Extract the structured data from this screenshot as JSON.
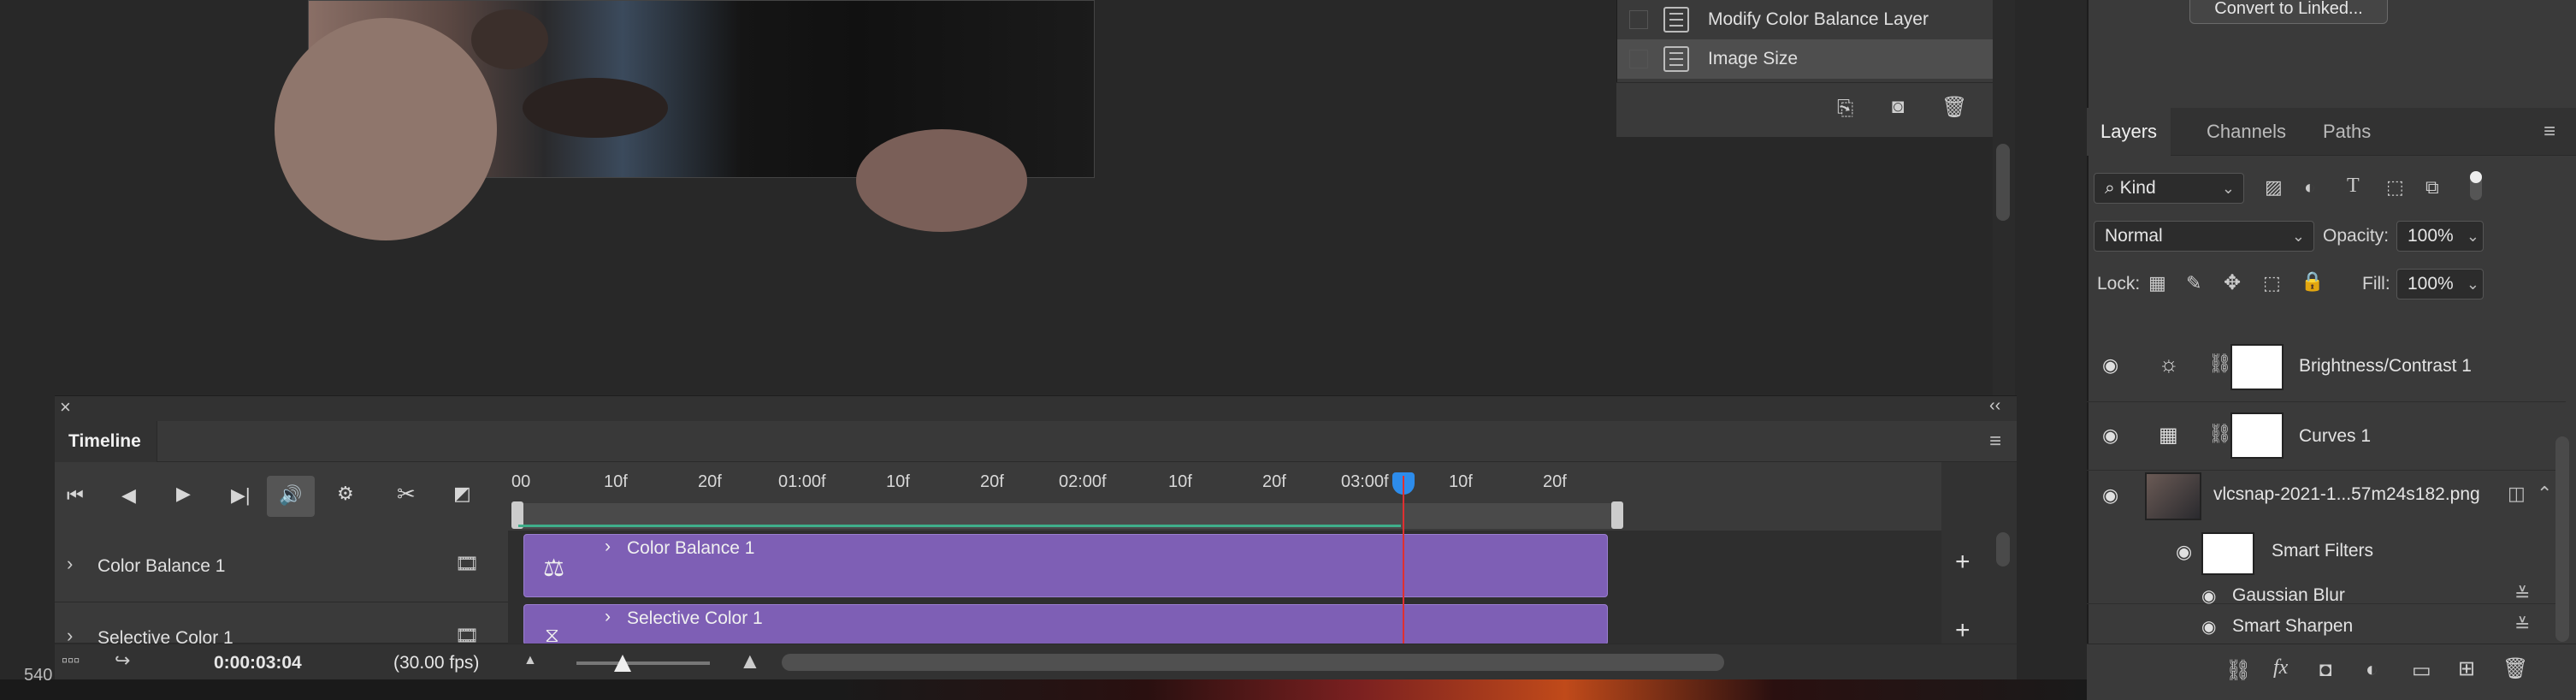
{
  "history": {
    "items": [
      {
        "label": "Modify Color Balance Layer",
        "selected": false
      },
      {
        "label": "Image Size",
        "selected": true
      }
    ],
    "footer_icons": [
      "new-snapshot-icon",
      "camera-icon",
      "trash-icon"
    ]
  },
  "convert_button": "Convert to Linked...",
  "layers": {
    "tabs": [
      "Layers",
      "Channels",
      "Paths"
    ],
    "active_tab": "Layers",
    "filter_kind": "Kind",
    "blend_mode": "Normal",
    "opacity_label": "Opacity:",
    "opacity_value": "100%",
    "lock_label": "Lock:",
    "fill_label": "Fill:",
    "fill_value": "100%",
    "items": [
      {
        "name": "Brightness/Contrast 1"
      },
      {
        "name": "Curves 1"
      },
      {
        "name": "vlcsnap-2021-1...57m24s182.png"
      }
    ],
    "smart_filters_label": "Smart Filters",
    "filters": [
      "Gaussian Blur",
      "Smart Sharpen"
    ],
    "footer_icons": [
      "link-icon",
      "fx-icon",
      "mask-icon",
      "adjustment-icon",
      "folder-icon",
      "new-layer-icon",
      "trash-icon"
    ],
    "fx_label": "fx"
  },
  "timeline": {
    "title": "Timeline",
    "close": "×",
    "collapse": "‹‹",
    "ruler_ticks": [
      "00",
      "10f",
      "20f",
      "01:00f",
      "10f",
      "20f",
      "02:00f",
      "10f",
      "20f",
      "03:00f",
      "10f",
      "20f"
    ],
    "tracks": [
      {
        "label": "Color Balance 1",
        "clip_label": "Color Balance 1"
      },
      {
        "label": "Selective Color 1",
        "clip_label": "Selective Color 1"
      }
    ],
    "timecode": "0:00:03:04",
    "fps": "(30.00 fps)",
    "zoom_left_icon": "small-mountain-icon",
    "zoom_right_icon": "large-mountain-icon",
    "add_label": "+"
  },
  "status_left": "540"
}
